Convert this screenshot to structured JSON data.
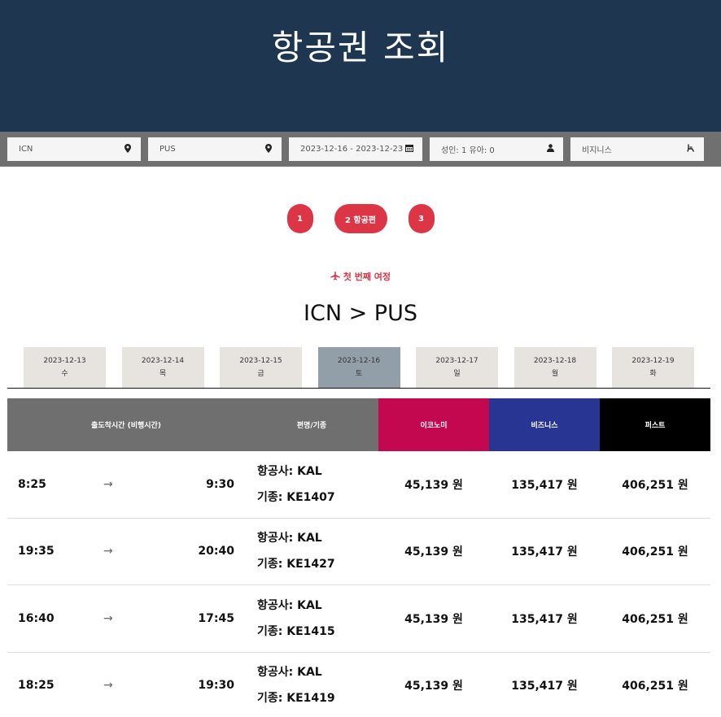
{
  "header": {
    "title": "항공권 조회"
  },
  "search": {
    "origin": "ICN",
    "destination": "PUS",
    "dates": "2023-12-16 - 2023-12-23",
    "passengers": "성인: 1 유아: 0",
    "cabin": "비지니스"
  },
  "steps": [
    {
      "label": "1"
    },
    {
      "label": "2 항공편"
    },
    {
      "label": "3"
    }
  ],
  "leg": {
    "icon": "plane-icon",
    "label": "첫 번째 여정"
  },
  "route": "ICN > PUS",
  "date_tabs": [
    {
      "date": "2023-12-13",
      "day": "수"
    },
    {
      "date": "2023-12-14",
      "day": "목"
    },
    {
      "date": "2023-12-15",
      "day": "금"
    },
    {
      "date": "2023-12-16",
      "day": "토",
      "active": true
    },
    {
      "date": "2023-12-17",
      "day": "일"
    },
    {
      "date": "2023-12-18",
      "day": "월"
    },
    {
      "date": "2023-12-19",
      "day": "화"
    }
  ],
  "table": {
    "headers": {
      "time": "출도착시간 (비행시간)",
      "flight": "편명/기종",
      "economy": "이코노미",
      "business": "비즈니스",
      "first": "퍼스트"
    },
    "airline_prefix": "항공사: ",
    "aircraft_prefix": "기종: ",
    "rows": [
      {
        "dep": "8:25",
        "arr": "9:30",
        "airline": "KAL",
        "aircraft": "KE1407",
        "economy": "45,139 원",
        "business": "135,417 원",
        "first": "406,251 원"
      },
      {
        "dep": "19:35",
        "arr": "20:40",
        "airline": "KAL",
        "aircraft": "KE1427",
        "economy": "45,139 원",
        "business": "135,417 원",
        "first": "406,251 원"
      },
      {
        "dep": "16:40",
        "arr": "17:45",
        "airline": "KAL",
        "aircraft": "KE1415",
        "economy": "45,139 원",
        "business": "135,417 원",
        "first": "406,251 원"
      },
      {
        "dep": "18:25",
        "arr": "19:30",
        "airline": "KAL",
        "aircraft": "KE1419",
        "economy": "45,139 원",
        "business": "135,417 원",
        "first": "406,251 원"
      }
    ]
  },
  "colors": {
    "header_bg": "#1e3650",
    "accent_red": "#dc3545",
    "economy": "#c4084f",
    "business": "#283593",
    "first": "#000000"
  }
}
